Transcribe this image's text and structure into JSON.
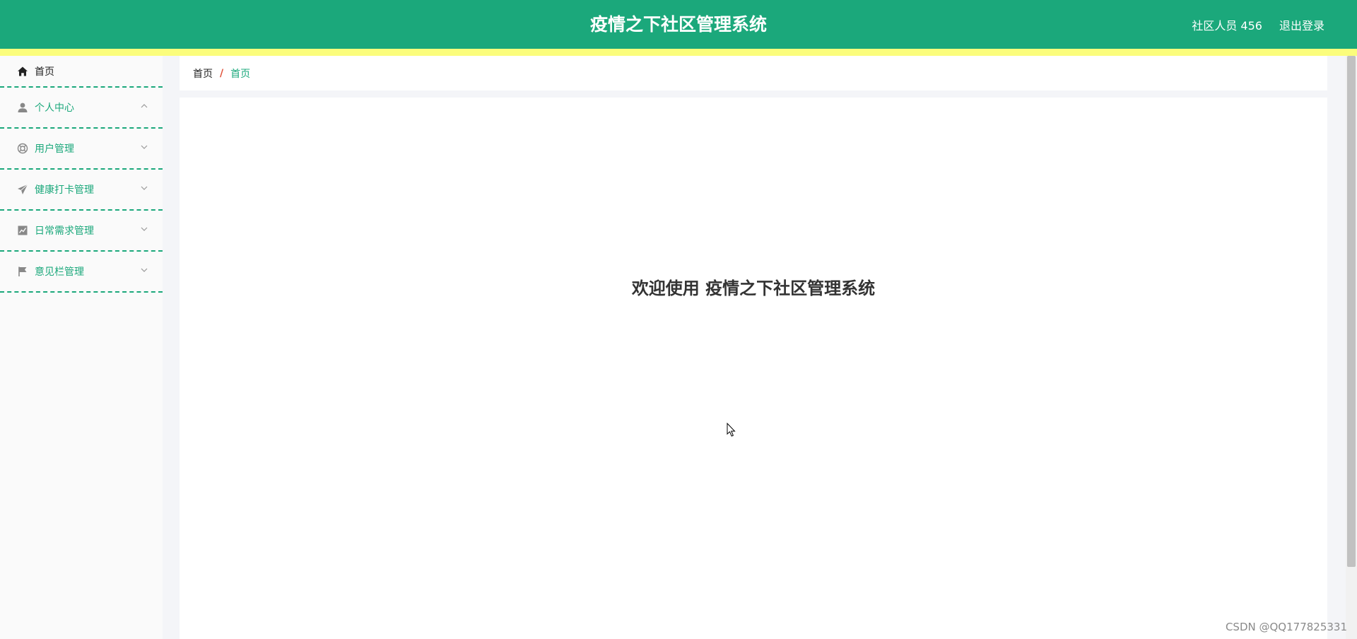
{
  "header": {
    "title": "疫情之下社区管理系统",
    "user_label": "社区人员 456",
    "logout_label": "退出登录"
  },
  "sidebar": {
    "items": [
      {
        "label": "首页",
        "icon": "home-icon"
      },
      {
        "label": "个人中心",
        "icon": "user-icon",
        "expanded": true
      },
      {
        "label": "用户管理",
        "icon": "lifebuoy-icon",
        "expanded": false
      },
      {
        "label": "健康打卡管理",
        "icon": "paper-plane-icon",
        "expanded": false
      },
      {
        "label": "日常需求管理",
        "icon": "chart-icon",
        "expanded": false
      },
      {
        "label": "意见栏管理",
        "icon": "flag-icon",
        "expanded": false
      }
    ]
  },
  "breadcrumb": {
    "root": "首页",
    "separator": "/",
    "current": "首页"
  },
  "main": {
    "welcome": "欢迎使用 疫情之下社区管理系统"
  },
  "watermark": "CSDN @QQ177825331",
  "colors": {
    "primary": "#1ba87b",
    "accent_bar": "#fbfd7c",
    "breadcrumb_separator": "#e0523a"
  }
}
